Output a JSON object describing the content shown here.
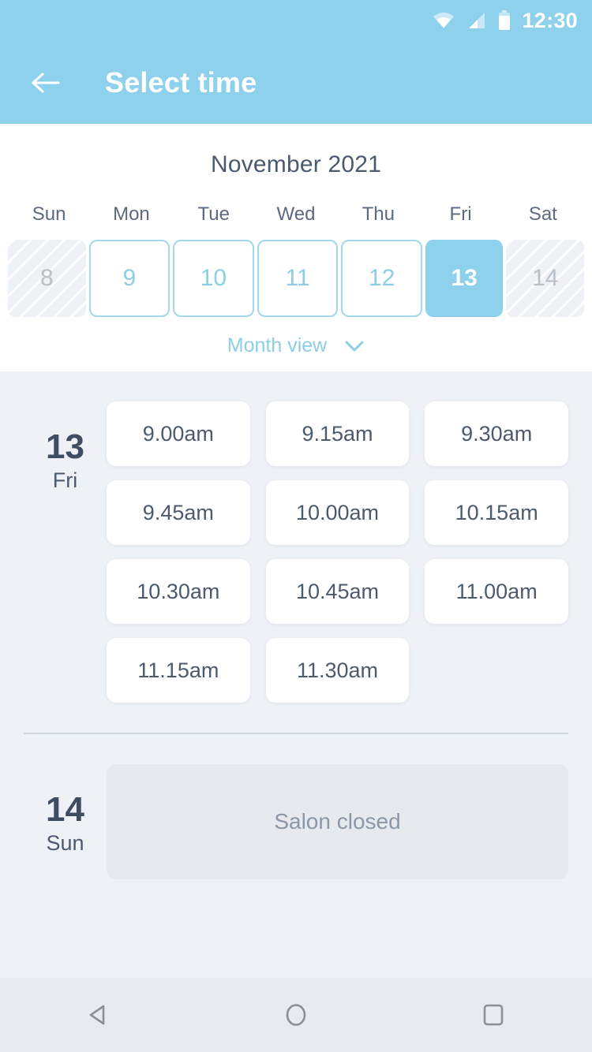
{
  "status_bar": {
    "time": "12:30",
    "icons": [
      "wifi-icon",
      "signal-icon",
      "battery-icon"
    ]
  },
  "app_bar": {
    "back_icon": "arrow-left-icon",
    "title": "Select time"
  },
  "calendar": {
    "month_label": "November 2021",
    "weekdays": [
      "Sun",
      "Mon",
      "Tue",
      "Wed",
      "Thu",
      "Fri",
      "Sat"
    ],
    "days": [
      {
        "num": "8",
        "state": "disabled"
      },
      {
        "num": "9",
        "state": "available"
      },
      {
        "num": "10",
        "state": "available"
      },
      {
        "num": "11",
        "state": "available"
      },
      {
        "num": "12",
        "state": "available"
      },
      {
        "num": "13",
        "state": "selected"
      },
      {
        "num": "14",
        "state": "disabled"
      }
    ],
    "month_view_label": "Month view",
    "month_view_icon": "chevron-down-icon"
  },
  "schedule": [
    {
      "date_num": "13",
      "day_of_week": "Fri",
      "slots": [
        "9.00am",
        "9.15am",
        "9.30am",
        "9.45am",
        "10.00am",
        "10.15am",
        "10.30am",
        "10.45am",
        "11.00am",
        "11.15am",
        "11.30am"
      ],
      "closed_message": null
    },
    {
      "date_num": "14",
      "day_of_week": "Sun",
      "slots": [],
      "closed_message": "Salon closed"
    }
  ],
  "nav_bar": {
    "back": "nav-back-icon",
    "home": "nav-home-icon",
    "recents": "nav-recents-icon"
  },
  "colors": {
    "accent": "#8ed1ec",
    "accent_border": "#a3d8ea",
    "page_bg": "#eef2f7",
    "text_dark": "#4c5a6e",
    "text_muted": "#8b97a8"
  }
}
